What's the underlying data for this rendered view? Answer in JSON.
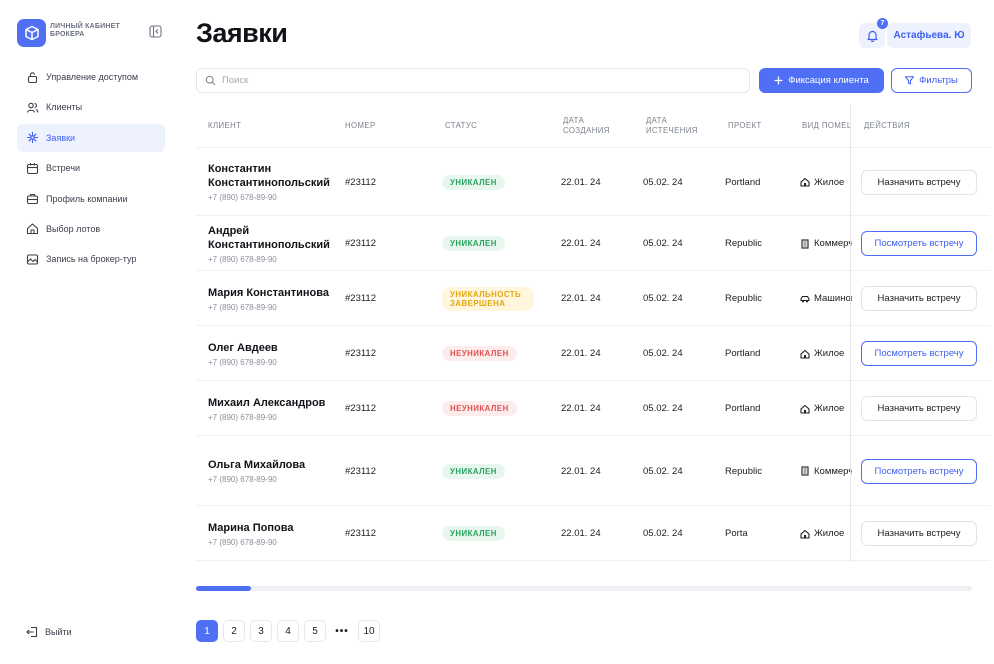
{
  "sidebar": {
    "brand": "ЛИЧНЫЙ КАБИНЕТ БРОКЕРА",
    "items": [
      {
        "label": "Управление доступом",
        "icon": "lock-icon"
      },
      {
        "label": "Клиенты",
        "icon": "users-icon"
      },
      {
        "label": "Заявки",
        "icon": "sparkle-icon",
        "active": true
      },
      {
        "label": "Встречи",
        "icon": "calendar-icon"
      },
      {
        "label": "Профиль компании",
        "icon": "briefcase-icon"
      },
      {
        "label": "Выбор лотов",
        "icon": "house-icon"
      },
      {
        "label": "Запись на брокер-тур",
        "icon": "image-icon"
      }
    ],
    "logout": "Выйти"
  },
  "header": {
    "title": "Заявки",
    "notifications": "7",
    "user": "Астафьева. Ю"
  },
  "toolbar": {
    "search_placeholder": "Поиск",
    "fix_client": "Фиксация клиента",
    "filters": "Фильтры"
  },
  "table": {
    "columns": [
      "КЛИЕНТ",
      "НОМЕР",
      "СТАТУС",
      "ДАТА СОЗДАНИЯ",
      "ДАТА ИСТЕЧЕНИЯ",
      "ПРОЕКТ",
      "ВИД ПОМЕЩЕНИЯ",
      "ДЕЙСТВИЯ"
    ],
    "rows": [
      {
        "name": "Константин Константинопольский",
        "phone": "+7 (890) 678-89-90",
        "number": "#23112",
        "status": "УНИКАЛЕН",
        "status_kind": "unique",
        "created": "22.01. 24",
        "expires": "05.02. 24",
        "project": "Portland",
        "type": "Жилое",
        "type_icon": "home-icon",
        "action": "Назначить встречу",
        "action_kind": "assign"
      },
      {
        "name": "Андрей Константинопольский",
        "phone": "+7 (890) 678-89-90",
        "number": "#23112",
        "status": "УНИКАЛЕН",
        "status_kind": "unique",
        "created": "22.01. 24",
        "expires": "05.02. 24",
        "project": "Republic",
        "type": "Коммерческое",
        "type_icon": "building-icon",
        "action": "Посмотреть встречу",
        "action_kind": "view"
      },
      {
        "name": "Мария Константинова",
        "phone": "+7 (890) 678-89-90",
        "number": "#23112",
        "status": "УНИКАЛЬНОСТЬ ЗАВЕРШЕНА",
        "status_kind": "done",
        "created": "22.01. 24",
        "expires": "05.02. 24",
        "project": "Republic",
        "type": "Машиноместо",
        "type_icon": "car-icon",
        "action": "Назначить встречу",
        "action_kind": "assign"
      },
      {
        "name": "Олег Авдеев",
        "phone": "+7 (890) 678-89-90",
        "number": "#23112",
        "status": "НЕУНИКАЛЕН",
        "status_kind": "not",
        "created": "22.01. 24",
        "expires": "05.02. 24",
        "project": "Portland",
        "type": "Жилое",
        "type_icon": "home-icon",
        "action": "Посмотреть встречу",
        "action_kind": "view"
      },
      {
        "name": "Михаил Александров",
        "phone": "+7 (890) 678-89-90",
        "number": "#23112",
        "status": "НЕУНИКАЛЕН",
        "status_kind": "not",
        "created": "22.01. 24",
        "expires": "05.02. 24",
        "project": "Portland",
        "type": "Жилое",
        "type_icon": "home-icon",
        "action": "Назначить встречу",
        "action_kind": "assign"
      },
      {
        "name": "Ольга Михайлова",
        "phone": "+7 (890) 678-89-90",
        "number": "#23112",
        "status": "УНИКАЛЕН",
        "status_kind": "unique",
        "created": "22.01. 24",
        "expires": "05.02. 24",
        "project": "Republic",
        "type": "Коммерческое",
        "type_icon": "building-icon",
        "action": "Посмотреть встречу",
        "action_kind": "view"
      },
      {
        "name": "Марина Попова",
        "phone": "+7 (890) 678-89-90",
        "number": "#23112",
        "status": "УНИКАЛЕН",
        "status_kind": "unique",
        "created": "22.01. 24",
        "expires": "05.02. 24",
        "project": "Porta",
        "type": "Жилое",
        "type_icon": "home-icon",
        "action": "Назначить встречу",
        "action_kind": "assign"
      }
    ]
  },
  "scroll": {
    "position": 0.07
  },
  "pagination": {
    "pages": [
      "1",
      "2",
      "3",
      "4",
      "5",
      "•••",
      "10"
    ],
    "current": "1"
  },
  "colors": {
    "accent": "#4f6ff5",
    "unique": "#27a360",
    "done": "#e0a80f",
    "not_unique": "#e05252"
  }
}
